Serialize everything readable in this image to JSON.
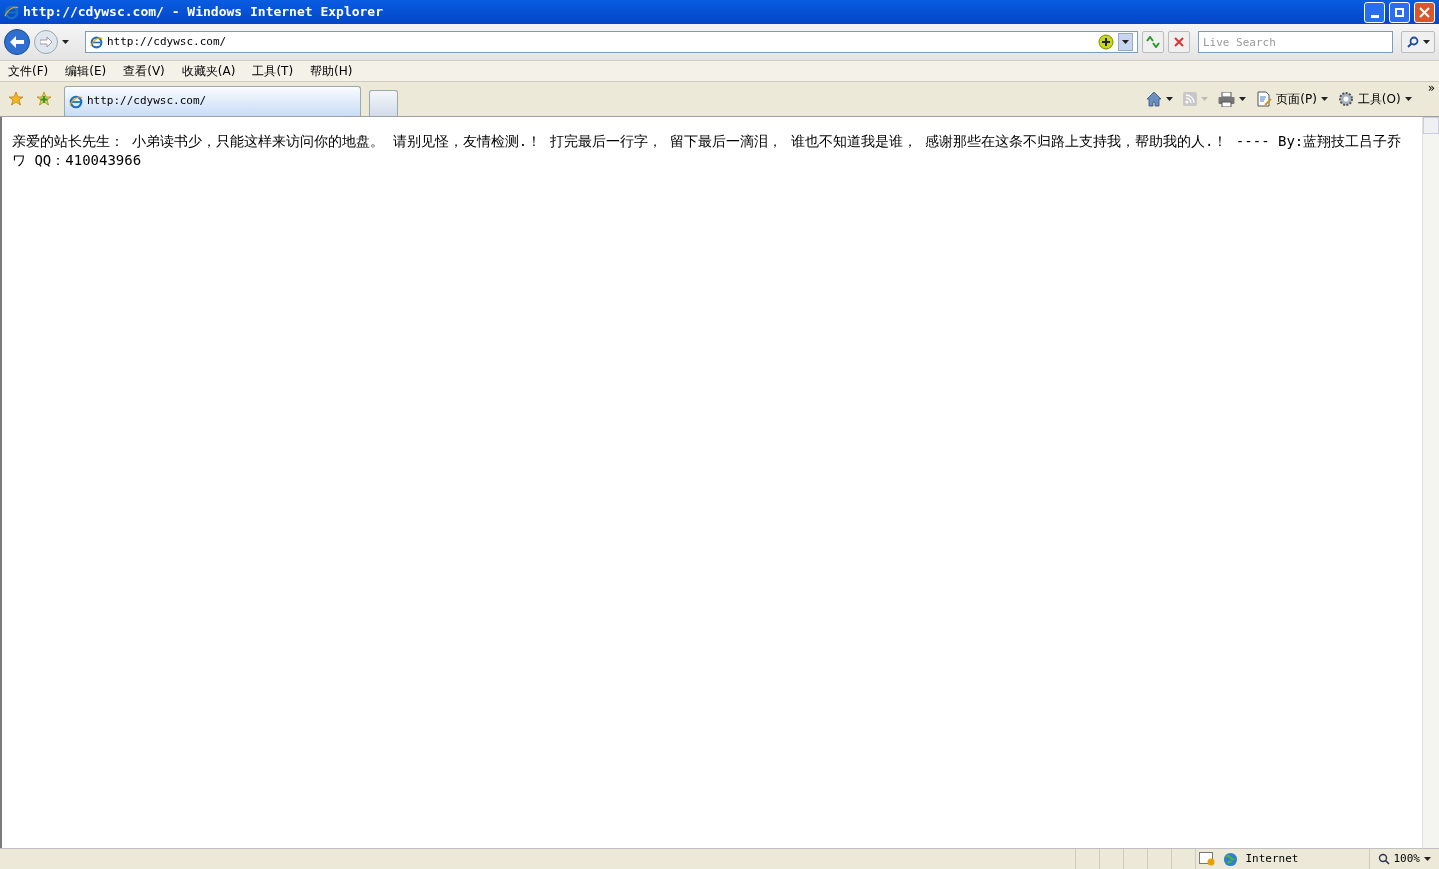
{
  "window": {
    "title": "http://cdywsc.com/ - Windows Internet Explorer"
  },
  "address_bar": {
    "url": "http://cdywsc.com/"
  },
  "search": {
    "placeholder": "Live Search"
  },
  "menu": [
    "文件(F)",
    "编辑(E)",
    "查看(V)",
    "收藏夹(A)",
    "工具(T)",
    "帮助(H)"
  ],
  "tabs": [
    {
      "title": "http://cdywsc.com/",
      "selected": true
    }
  ],
  "command_bar": [
    {
      "kind": "home",
      "disabled": false
    },
    {
      "kind": "feeds",
      "disabled": true
    },
    {
      "kind": "print",
      "disabled": false
    },
    {
      "kind": "page",
      "label": "页面(P)",
      "disabled": false
    },
    {
      "kind": "tools",
      "label": "工具(O)",
      "disabled": false
    }
  ],
  "more": "»",
  "content": {
    "text": "亲爱的站长先生：  小弟读书少，只能这样来访问你的地盘。 请别见怪，友情检测.！ 打完最后一行字， 留下最后一滴泪， 谁也不知道我是谁， 感谢那些在这条不归路上支持我，帮助我的人.！ ---- By:蓝翔技工吕子乔ワ QQ：410043966"
  },
  "status_bar": {
    "zone": "Internet",
    "zoom": "100%"
  }
}
